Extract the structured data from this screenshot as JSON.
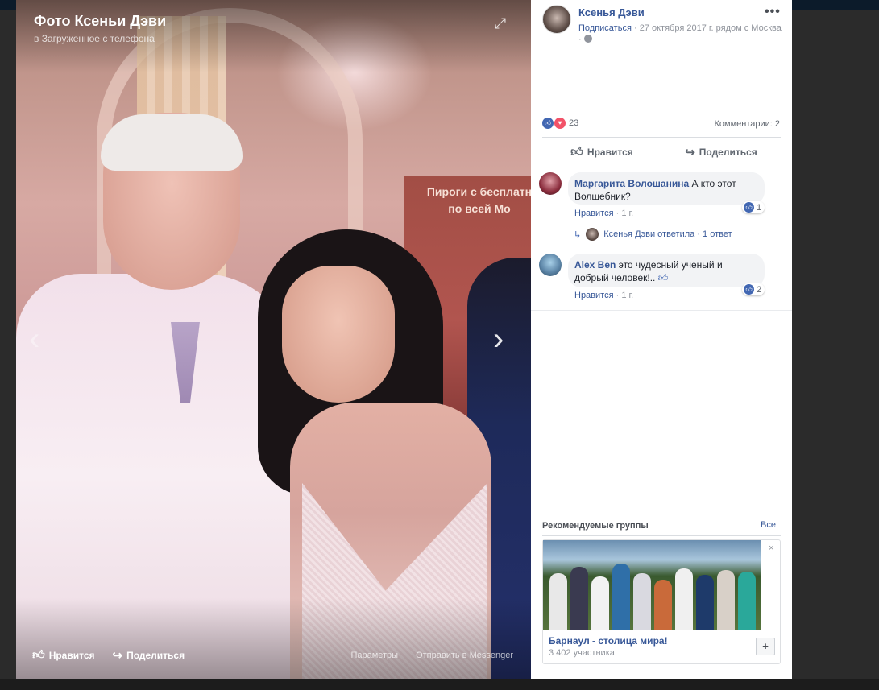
{
  "photo": {
    "title": "Фото Ксеньи Дэви",
    "subtitle": "в Загруженное с телефона",
    "banner_line1": "Пироги с бесплатн",
    "banner_line2": "по всей Мо",
    "actions": {
      "like": "Нравится",
      "share": "Поделиться"
    },
    "links": {
      "options": "Параметры",
      "messenger": "Отправить в Messenger"
    }
  },
  "post": {
    "author": "Ксенья Дэви",
    "more": "•••",
    "follow": "Подписаться",
    "meta": "· 27 октября 2017 г. рядом с Москва",
    "meta_dot": "·",
    "reactions_count": "23",
    "comments_count": "Комментарии: 2",
    "like_label": "Нравится",
    "share_label": "Поделиться"
  },
  "comments": [
    {
      "author": "Маргарита Волошанина",
      "text": "А кто этот Волшебник?",
      "reply": "Нравится",
      "time": "1 г.",
      "likes": "1",
      "reply_thread": {
        "text": "Ксенья Дэви ответила · 1 ответ"
      }
    },
    {
      "author": "Alex Ben",
      "text": "это чудесный ученый и добрый человек!..",
      "reply": "Нравится",
      "time": "1 г.",
      "likes": "2"
    }
  ],
  "groups": {
    "title": "Рекомендуемые группы",
    "all": "Все",
    "card": {
      "name": "Барнаул - столица мира!",
      "members": "3 402 участника",
      "join": "+",
      "close": "×"
    }
  },
  "colors": {
    "link": "#385898",
    "like": "#4267b2",
    "love": "#f25268"
  },
  "icons": [
    "expand-icon",
    "chevron-left-icon",
    "chevron-right-icon",
    "thumbs-up-icon",
    "share-icon",
    "globe-icon",
    "like-reaction-icon",
    "love-reaction-icon",
    "reply-arrow-icon",
    "close-icon",
    "plus-icon"
  ]
}
